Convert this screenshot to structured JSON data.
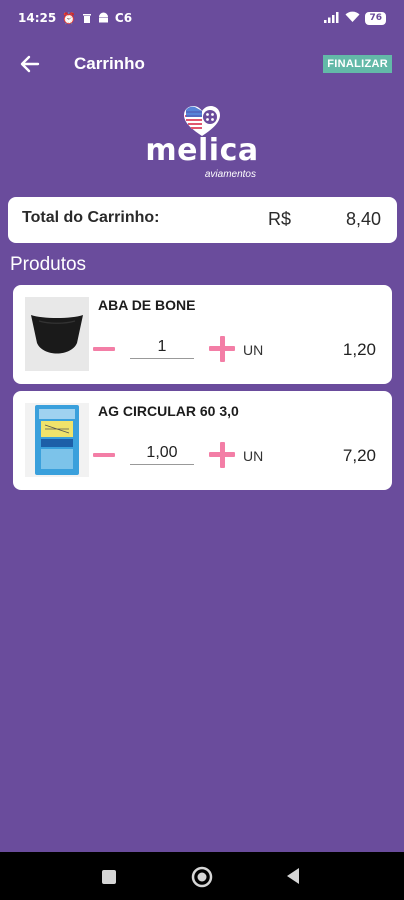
{
  "status_bar": {
    "time": "14:25",
    "carrier": "C6",
    "battery": "76",
    "icons": [
      "alarm-icon",
      "delete-icon",
      "android-icon",
      "signal-icon",
      "wifi-icon",
      "battery-icon"
    ]
  },
  "app_bar": {
    "title": "Carrinho",
    "finalizar_label": "FINALIZAR",
    "back_icon": "arrow-left-icon"
  },
  "logo": {
    "name": "melica",
    "subtitle": "aviamentos"
  },
  "cart_total": {
    "label": "Total do Carrinho:",
    "currency": "R$",
    "value": "8,40"
  },
  "products_section": {
    "title": "Produtos",
    "items": [
      {
        "name": "ABA DE BONE",
        "quantity": "1",
        "unit": "UN",
        "price": "1,20",
        "image": "cap-visor-image"
      },
      {
        "name": "AG CIRCULAR 60 3,0",
        "quantity": "1,00",
        "unit": "UN",
        "price": "7,20",
        "image": "needle-pack-image"
      }
    ]
  },
  "nav_bar": {
    "buttons": [
      "recents-square-icon",
      "home-circle-icon",
      "back-triangle-icon"
    ]
  },
  "colors": {
    "background": "#6a4c9c",
    "accent_pink": "#f37ea6",
    "finalizar_bg": "#63b9a8",
    "card": "#ffffff"
  }
}
